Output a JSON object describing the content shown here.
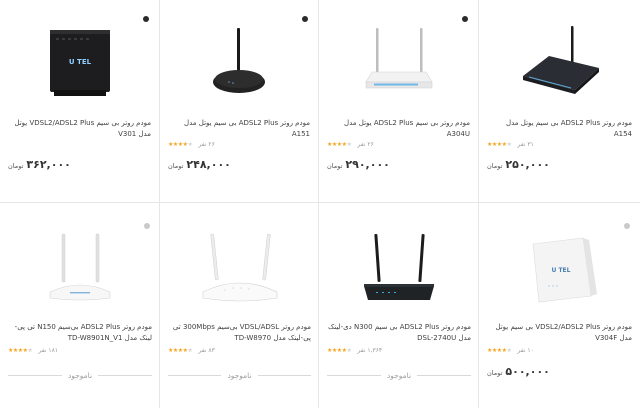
{
  "products": [
    {
      "title": "مودم روتر بی سیم VDSL2/ADSL2 Plus یوتل مدل V301",
      "price": "۳۶۲,۰۰۰",
      "currency": "تومان",
      "rating_count": "",
      "stars": 0,
      "status": ""
    },
    {
      "title": "مودم روتر ADSL2 Plus بی سیم یوتل مدل A151",
      "price": "۲۴۸,۰۰۰",
      "currency": "تومان",
      "rating_count": "۲۶ نفر",
      "stars": 4,
      "status": ""
    },
    {
      "title": "مودم روتر بی سیم ADSL2 Plus یوتل مدل A304U",
      "price": "۲۹۰,۰۰۰",
      "currency": "تومان",
      "rating_count": "۲۶ نفر",
      "stars": 4,
      "status": ""
    },
    {
      "title": "مودم روتر ADSL2 Plus بی سیم یوتل مدل A154",
      "price": "۲۵۰,۰۰۰",
      "currency": "تومان",
      "rating_count": "۳۱ نفر",
      "stars": 4,
      "status": ""
    },
    {
      "title": "مودم روتر ADSL2 Plus بی‌سیم N150 تی پی-لینک مدل TD-W8901N_V1",
      "price": "",
      "currency": "",
      "rating_count": "۱۸۱ نفر",
      "stars": 4,
      "status": "ناموجود"
    },
    {
      "title": "مودم روتر VDSL/ADSL بی‌سیم 300Mbps تی پی-لینک مدل TD-W8970",
      "price": "",
      "currency": "",
      "rating_count": "۸۳ نفر",
      "stars": 4,
      "status": "ناموجود"
    },
    {
      "title": "مودم روتر ADSL2 Plus بی سیم N300 دی-لینک مدل DSL-2740U",
      "price": "",
      "currency": "",
      "rating_count": "۱,۳۶۴ نفر",
      "stars": 4,
      "status": "ناموجود"
    },
    {
      "title": "مودم روتر VDSL2/ADSL2 Plus بی سیم یوتل مدل V304F",
      "price": "۵۰۰,۰۰۰",
      "currency": "تومان",
      "rating_count": "۱۰ نفر",
      "stars": 4,
      "status": ""
    }
  ],
  "brand_logo_text": "U TEL",
  "colors": {
    "star": "#f5a623",
    "text": "#404040",
    "divider": "#e6e6e6"
  }
}
